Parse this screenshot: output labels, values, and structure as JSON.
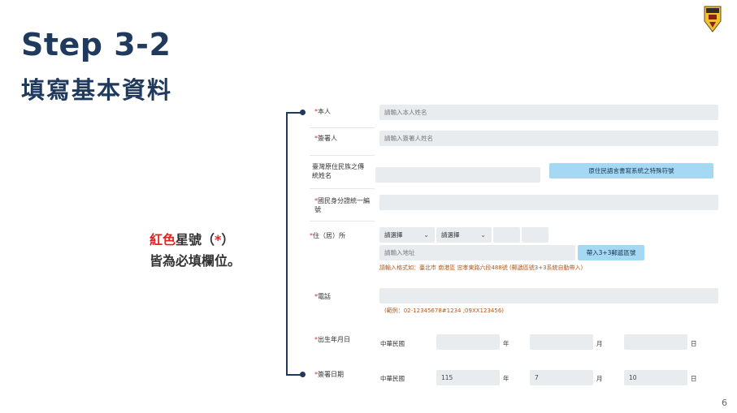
{
  "slide": {
    "title": "Step 3-2",
    "subtitle": "填寫基本資料",
    "page_number": "6"
  },
  "note": {
    "part1_red": "紅色",
    "part2": "星號（",
    "part3_red": "*",
    "part4": "）",
    "line2": "皆為必填欄位。"
  },
  "form": {
    "star": "*",
    "name": {
      "label": "本人",
      "placeholder": "請輸入本人姓名"
    },
    "signer": {
      "label": "簽署人",
      "placeholder": "請輸入簽署人姓名"
    },
    "indigenous": {
      "label_line1": "臺灣原住民族之傳",
      "label_line2": "統姓名",
      "button": "原住民語言書寫系統之特殊符號"
    },
    "id_number": {
      "label_line1": "國民身分證統一編",
      "label_line2": "號"
    },
    "address": {
      "label": "住（居）所",
      "select1": "請選擇",
      "select2": "請選擇",
      "placeholder": "請輸入地址",
      "button": "帶入3+3郵遞區號",
      "hint": "請輸入格式如：臺北市 南港區 忠孝東路六段488號 (郵遞區號3+3系統自動帶入)"
    },
    "phone": {
      "label": "電話",
      "hint": "(範例：02-12345678#1234 ;09XX123456)"
    },
    "birth": {
      "label": "出生年月日",
      "era": "中華民國",
      "year_unit": "年",
      "month_unit": "月",
      "day_unit": "日"
    },
    "sign_date": {
      "label": "簽署日期",
      "era": "中華民國",
      "year": "115",
      "month": "7",
      "day": "10",
      "year_unit": "年",
      "month_unit": "月",
      "day_unit": "日"
    }
  },
  "colors": {
    "title": "#1f3a5c",
    "required": "#d32f2f",
    "note_red": "#e02424",
    "button": "#a5d9f3",
    "input": "#e9ecef",
    "hint": "#b0581a"
  },
  "icons": {
    "logo": "school-emblem-icon",
    "chevron": "chevron-down-icon"
  }
}
